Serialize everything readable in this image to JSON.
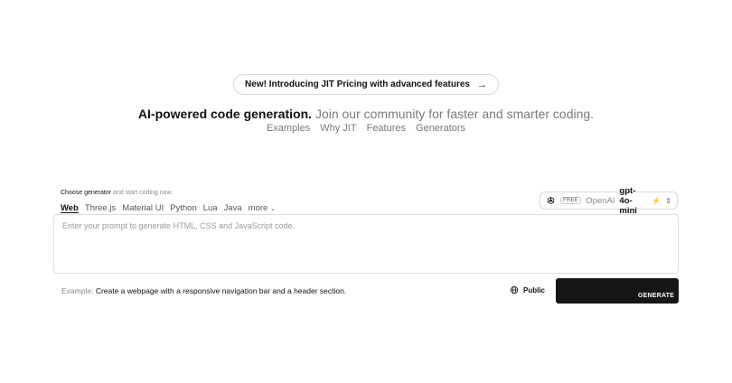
{
  "announcement": {
    "text": "New! Introducing JIT Pricing with advanced features",
    "arrow": "→"
  },
  "tagline": {
    "bold": "AI-powered code generation.",
    "light": "Join our community for faster and smarter coding."
  },
  "nav_links": [
    "Examples",
    "Why JIT",
    "Features",
    "Generators"
  ],
  "choose": {
    "bold": "Choose generator",
    "rest": "and start coding now."
  },
  "generators": {
    "items": [
      "Web",
      "Three.js",
      "Material UI",
      "Python",
      "Lua",
      "Java"
    ],
    "active": "Web",
    "more_label": "more"
  },
  "model_selector": {
    "badge": "FREE",
    "provider": "OpenAI",
    "model": "gpt-4o-mini",
    "icon": "openai-logo-icon"
  },
  "prompt": {
    "placeholder": "Enter your prompt to generate HTML, CSS and JavaScript code.",
    "value": ""
  },
  "example": {
    "label": "Example:",
    "text": "Create a webpage with a responsive navigation bar and a header section."
  },
  "visibility": {
    "label": "Public",
    "icon": "globe-icon"
  },
  "generate": {
    "label": "GENERATE",
    "bg_color": "#161616"
  }
}
